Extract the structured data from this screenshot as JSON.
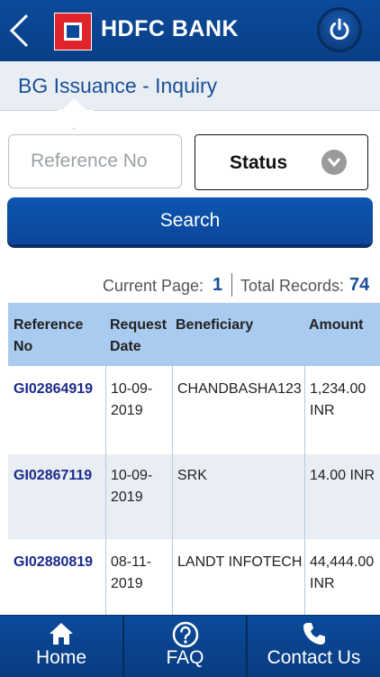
{
  "header": {
    "brand": "HDFC BANK",
    "back_icon": "chevron-left-icon",
    "power_icon": "power-icon"
  },
  "page": {
    "title": "BG Issuance - Inquiry"
  },
  "filters": {
    "reference_placeholder": "Reference No",
    "reference_value": "",
    "status_label": "Status"
  },
  "search": {
    "label": "Search"
  },
  "pagination": {
    "current_page_label": "Current Page:",
    "current_page": "1",
    "total_records_label": "Total Records:",
    "total_records": "74"
  },
  "table": {
    "headers": {
      "reference_line1": "Reference",
      "reference_line2": "No",
      "request_line1": "Request",
      "request_line2": "Date",
      "beneficiary": "Beneficiary",
      "amount": "Amount"
    },
    "rows": [
      {
        "ref": "GI02864919",
        "date1": "10-09-",
        "date2": "2019",
        "beneficiary": "CHANDBASHA123",
        "amount1": "1,234.00",
        "amount2": "INR"
      },
      {
        "ref": "GI02867119",
        "date1": "10-09-",
        "date2": "2019",
        "beneficiary": "SRK",
        "amount1": "14.00 INR",
        "amount2": ""
      },
      {
        "ref": "GI02880819",
        "date1": "08-11-",
        "date2": "2019",
        "beneficiary": "LANDT INFOTECH",
        "amount1": "44,444.00",
        "amount2": "INR"
      }
    ]
  },
  "nav": {
    "home": "Home",
    "faq": "FAQ",
    "contact": "Contact Us"
  },
  "colors": {
    "primary": "#0b4a9a",
    "accent_red": "#e0242b",
    "header_row": "#a9cbef",
    "alt_row": "#e9eef5"
  }
}
